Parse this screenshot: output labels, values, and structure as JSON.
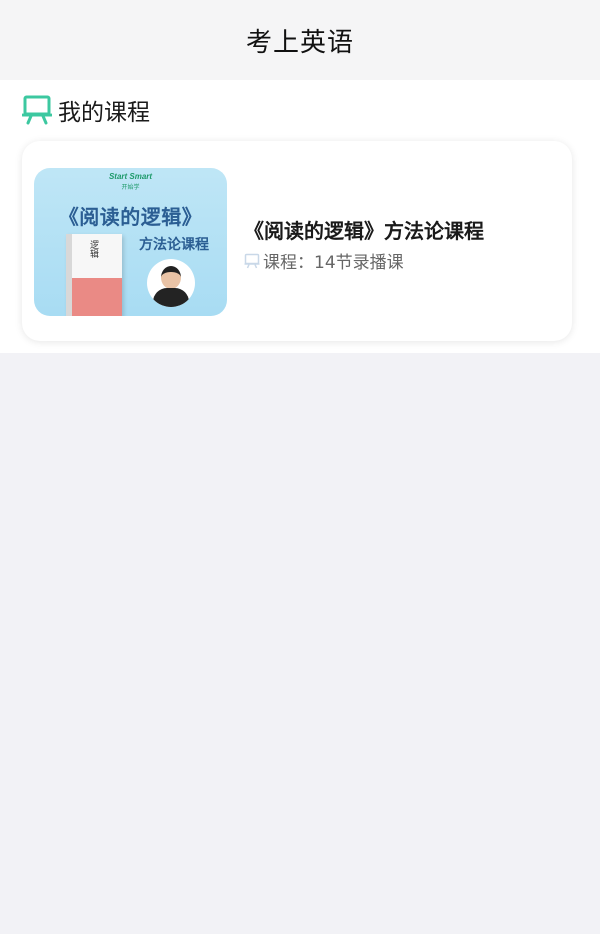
{
  "header": {
    "title": "考上英语"
  },
  "section": {
    "title": "我的课程",
    "icon": "presentation-board-icon",
    "accent_color": "#3cc8a0"
  },
  "courses": [
    {
      "thumbnail": {
        "brand": "Start Smart",
        "brand_sub": "开始学",
        "title": "《阅读的逻辑》",
        "subtitle": "方法论课程",
        "book_title": "逻辑"
      },
      "title": "《阅读的逻辑》方法论课程",
      "meta_icon": "presentation-board-icon",
      "meta": "课程：14节录播课"
    }
  ]
}
